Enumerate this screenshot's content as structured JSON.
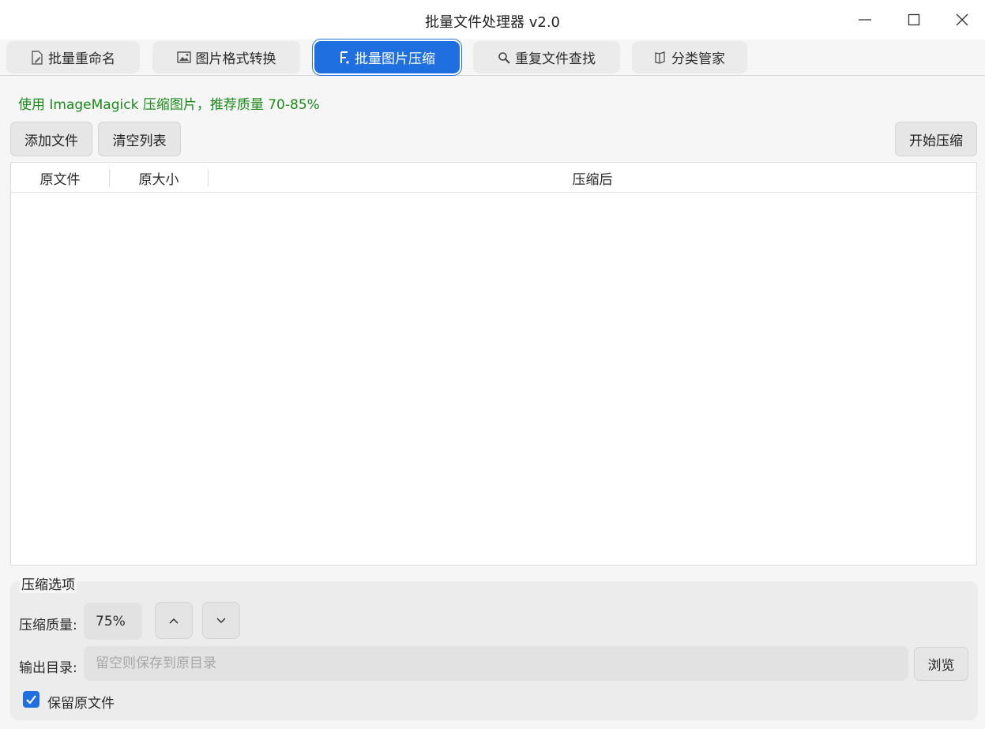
{
  "window": {
    "title": "批量文件处理器 v2.0"
  },
  "tabs": [
    {
      "label": "批量重命名",
      "icon": "document-edit-icon"
    },
    {
      "label": "图片格式转换",
      "icon": "image-icon"
    },
    {
      "label": "批量图片压缩",
      "icon": "compress-icon",
      "active": true
    },
    {
      "label": "重复文件查找",
      "icon": "search-icon"
    },
    {
      "label": "分类管家",
      "icon": "folder-icon"
    }
  ],
  "compress": {
    "tip": "使用 ImageMagick 压缩图片，推荐质量 70-85%",
    "add_files": "添加文件",
    "clear_list": "清空列表",
    "start": "开始压缩",
    "columns": [
      "原文件",
      "原大小",
      "压缩后"
    ],
    "options_title": "压缩选项",
    "quality_label": "压缩质量:",
    "quality_value": "75%",
    "output_label": "输出目录:",
    "output_placeholder": "留空则保存到原目录",
    "output_value": "",
    "browse": "浏览",
    "keep_original_label": "保留原文件",
    "keep_original_checked": true
  },
  "colors": {
    "accent": "#1f6fe0",
    "tip_green": "#1a8a1a"
  }
}
